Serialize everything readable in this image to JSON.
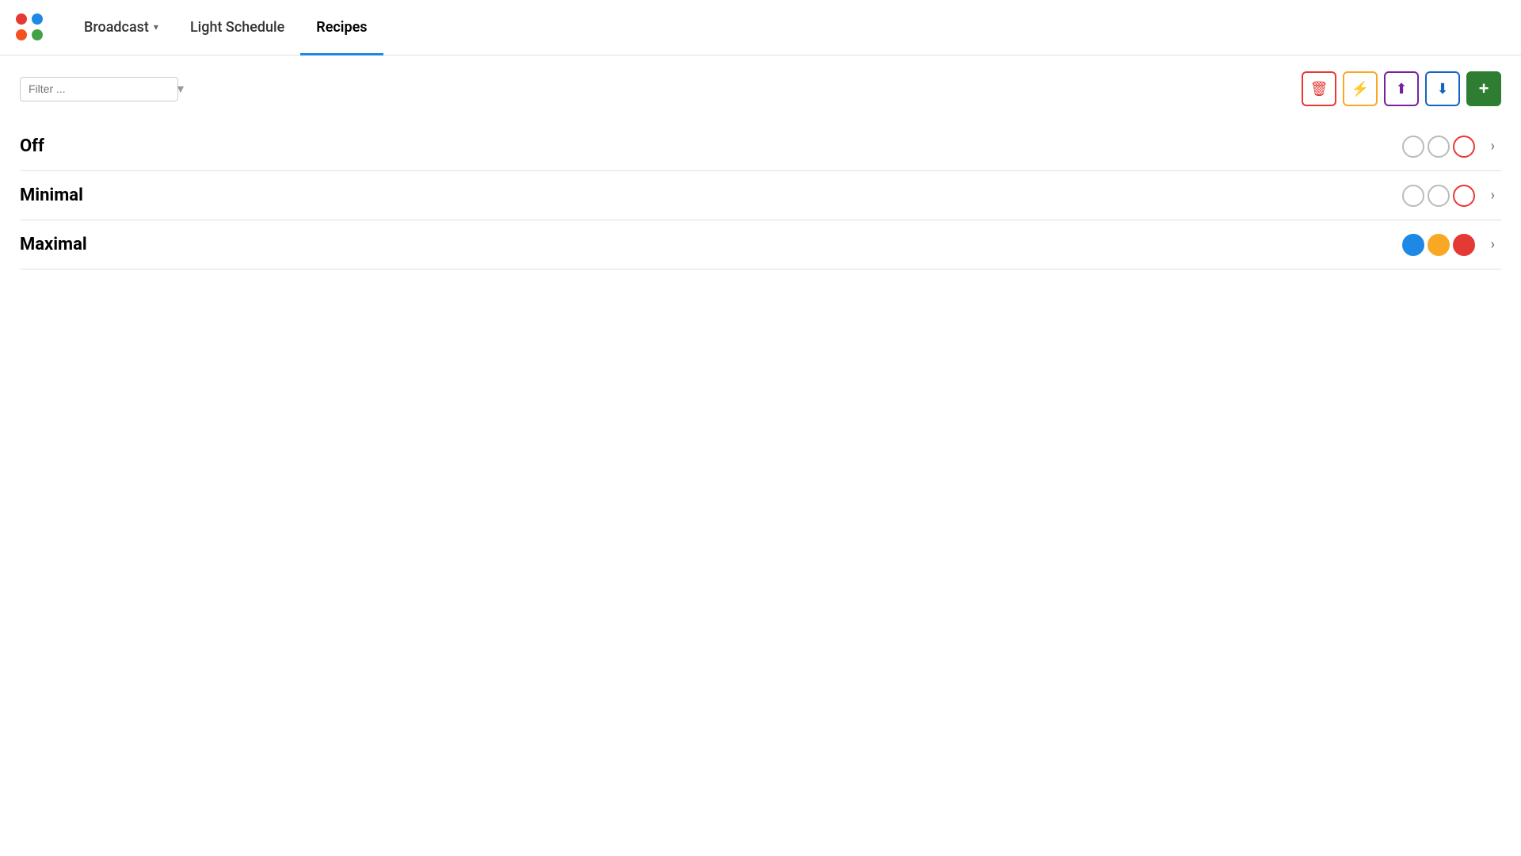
{
  "logo": {
    "dots": [
      {
        "color": "red",
        "label": "dot-red"
      },
      {
        "color": "blue",
        "label": "dot-blue"
      },
      {
        "color": "orange",
        "label": "dot-orange"
      },
      {
        "color": "green",
        "label": "dot-green"
      }
    ]
  },
  "nav": {
    "items": [
      {
        "label": "Broadcast",
        "has_dropdown": true,
        "active": false
      },
      {
        "label": "Light Schedule",
        "has_dropdown": false,
        "active": false
      },
      {
        "label": "Recipes",
        "has_dropdown": false,
        "active": true
      }
    ]
  },
  "toolbar": {
    "filter_placeholder": "Filter ...",
    "buttons": [
      {
        "label": "🗑",
        "type": "red",
        "name": "delete-button"
      },
      {
        "label": "⚡",
        "type": "yellow",
        "name": "flash-button"
      },
      {
        "label": "↑",
        "type": "purple",
        "name": "upload-button"
      },
      {
        "label": "↓",
        "type": "blue-outline",
        "name": "download-button"
      },
      {
        "label": "+",
        "type": "green-filled",
        "name": "add-button"
      }
    ]
  },
  "recipes": [
    {
      "name": "Off",
      "circles": [
        {
          "type": "empty-gray"
        },
        {
          "type": "empty-gray"
        },
        {
          "type": "empty-red"
        }
      ]
    },
    {
      "name": "Minimal",
      "circles": [
        {
          "type": "empty-gray"
        },
        {
          "type": "empty-gray"
        },
        {
          "type": "empty-red"
        }
      ]
    },
    {
      "name": "Maximal",
      "circles": [
        {
          "type": "filled-blue"
        },
        {
          "type": "filled-yellow"
        },
        {
          "type": "filled-red"
        }
      ]
    }
  ]
}
